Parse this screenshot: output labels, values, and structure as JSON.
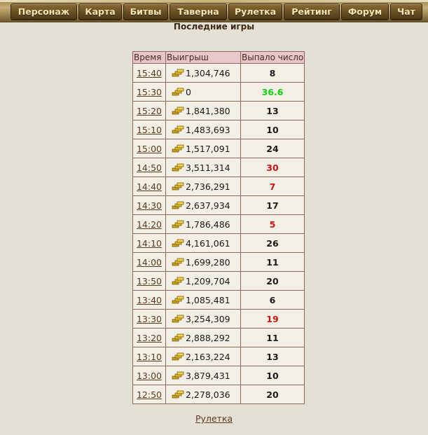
{
  "nav": [
    {
      "label": "Персонаж"
    },
    {
      "label": "Карта"
    },
    {
      "label": "Битвы"
    },
    {
      "label": "Таверна"
    },
    {
      "label": "Рулетка"
    },
    {
      "label": "Рейтинг"
    },
    {
      "label": "Форум"
    },
    {
      "label": "Чат"
    }
  ],
  "page_title": "Последние игры",
  "table": {
    "headers": [
      "Время",
      "Выигрыш",
      "Выпало число"
    ],
    "rows": [
      {
        "time": "15:40",
        "win": "1,304,746",
        "num": "8",
        "color": "black"
      },
      {
        "time": "15:30",
        "win": "0",
        "num": "36.6",
        "color": "green"
      },
      {
        "time": "15:20",
        "win": "1,841,380",
        "num": "13",
        "color": "black"
      },
      {
        "time": "15:10",
        "win": "1,483,693",
        "num": "10",
        "color": "black"
      },
      {
        "time": "15:00",
        "win": "1,517,091",
        "num": "24",
        "color": "black"
      },
      {
        "time": "14:50",
        "win": "3,511,314",
        "num": "30",
        "color": "red"
      },
      {
        "time": "14:40",
        "win": "2,736,291",
        "num": "7",
        "color": "red"
      },
      {
        "time": "14:30",
        "win": "2,637,934",
        "num": "17",
        "color": "black"
      },
      {
        "time": "14:20",
        "win": "1,786,486",
        "num": "5",
        "color": "red"
      },
      {
        "time": "14:10",
        "win": "4,161,061",
        "num": "26",
        "color": "black"
      },
      {
        "time": "14:00",
        "win": "1,699,280",
        "num": "11",
        "color": "black"
      },
      {
        "time": "13:50",
        "win": "1,209,704",
        "num": "20",
        "color": "black"
      },
      {
        "time": "13:40",
        "win": "1,085,481",
        "num": "6",
        "color": "black"
      },
      {
        "time": "13:30",
        "win": "3,254,309",
        "num": "19",
        "color": "red"
      },
      {
        "time": "13:20",
        "win": "2,888,292",
        "num": "11",
        "color": "black"
      },
      {
        "time": "13:10",
        "win": "2,163,224",
        "num": "13",
        "color": "black"
      },
      {
        "time": "13:00",
        "win": "3,879,431",
        "num": "10",
        "color": "black"
      },
      {
        "time": "12:50",
        "win": "2,278,036",
        "num": "20",
        "color": "black"
      }
    ]
  },
  "footer_link": "Рулетка",
  "icons": {
    "win_icon": "gold-coins-icon"
  },
  "colors": {
    "red": "#c81414",
    "green": "#12d012",
    "background": "#e4e1d4"
  }
}
